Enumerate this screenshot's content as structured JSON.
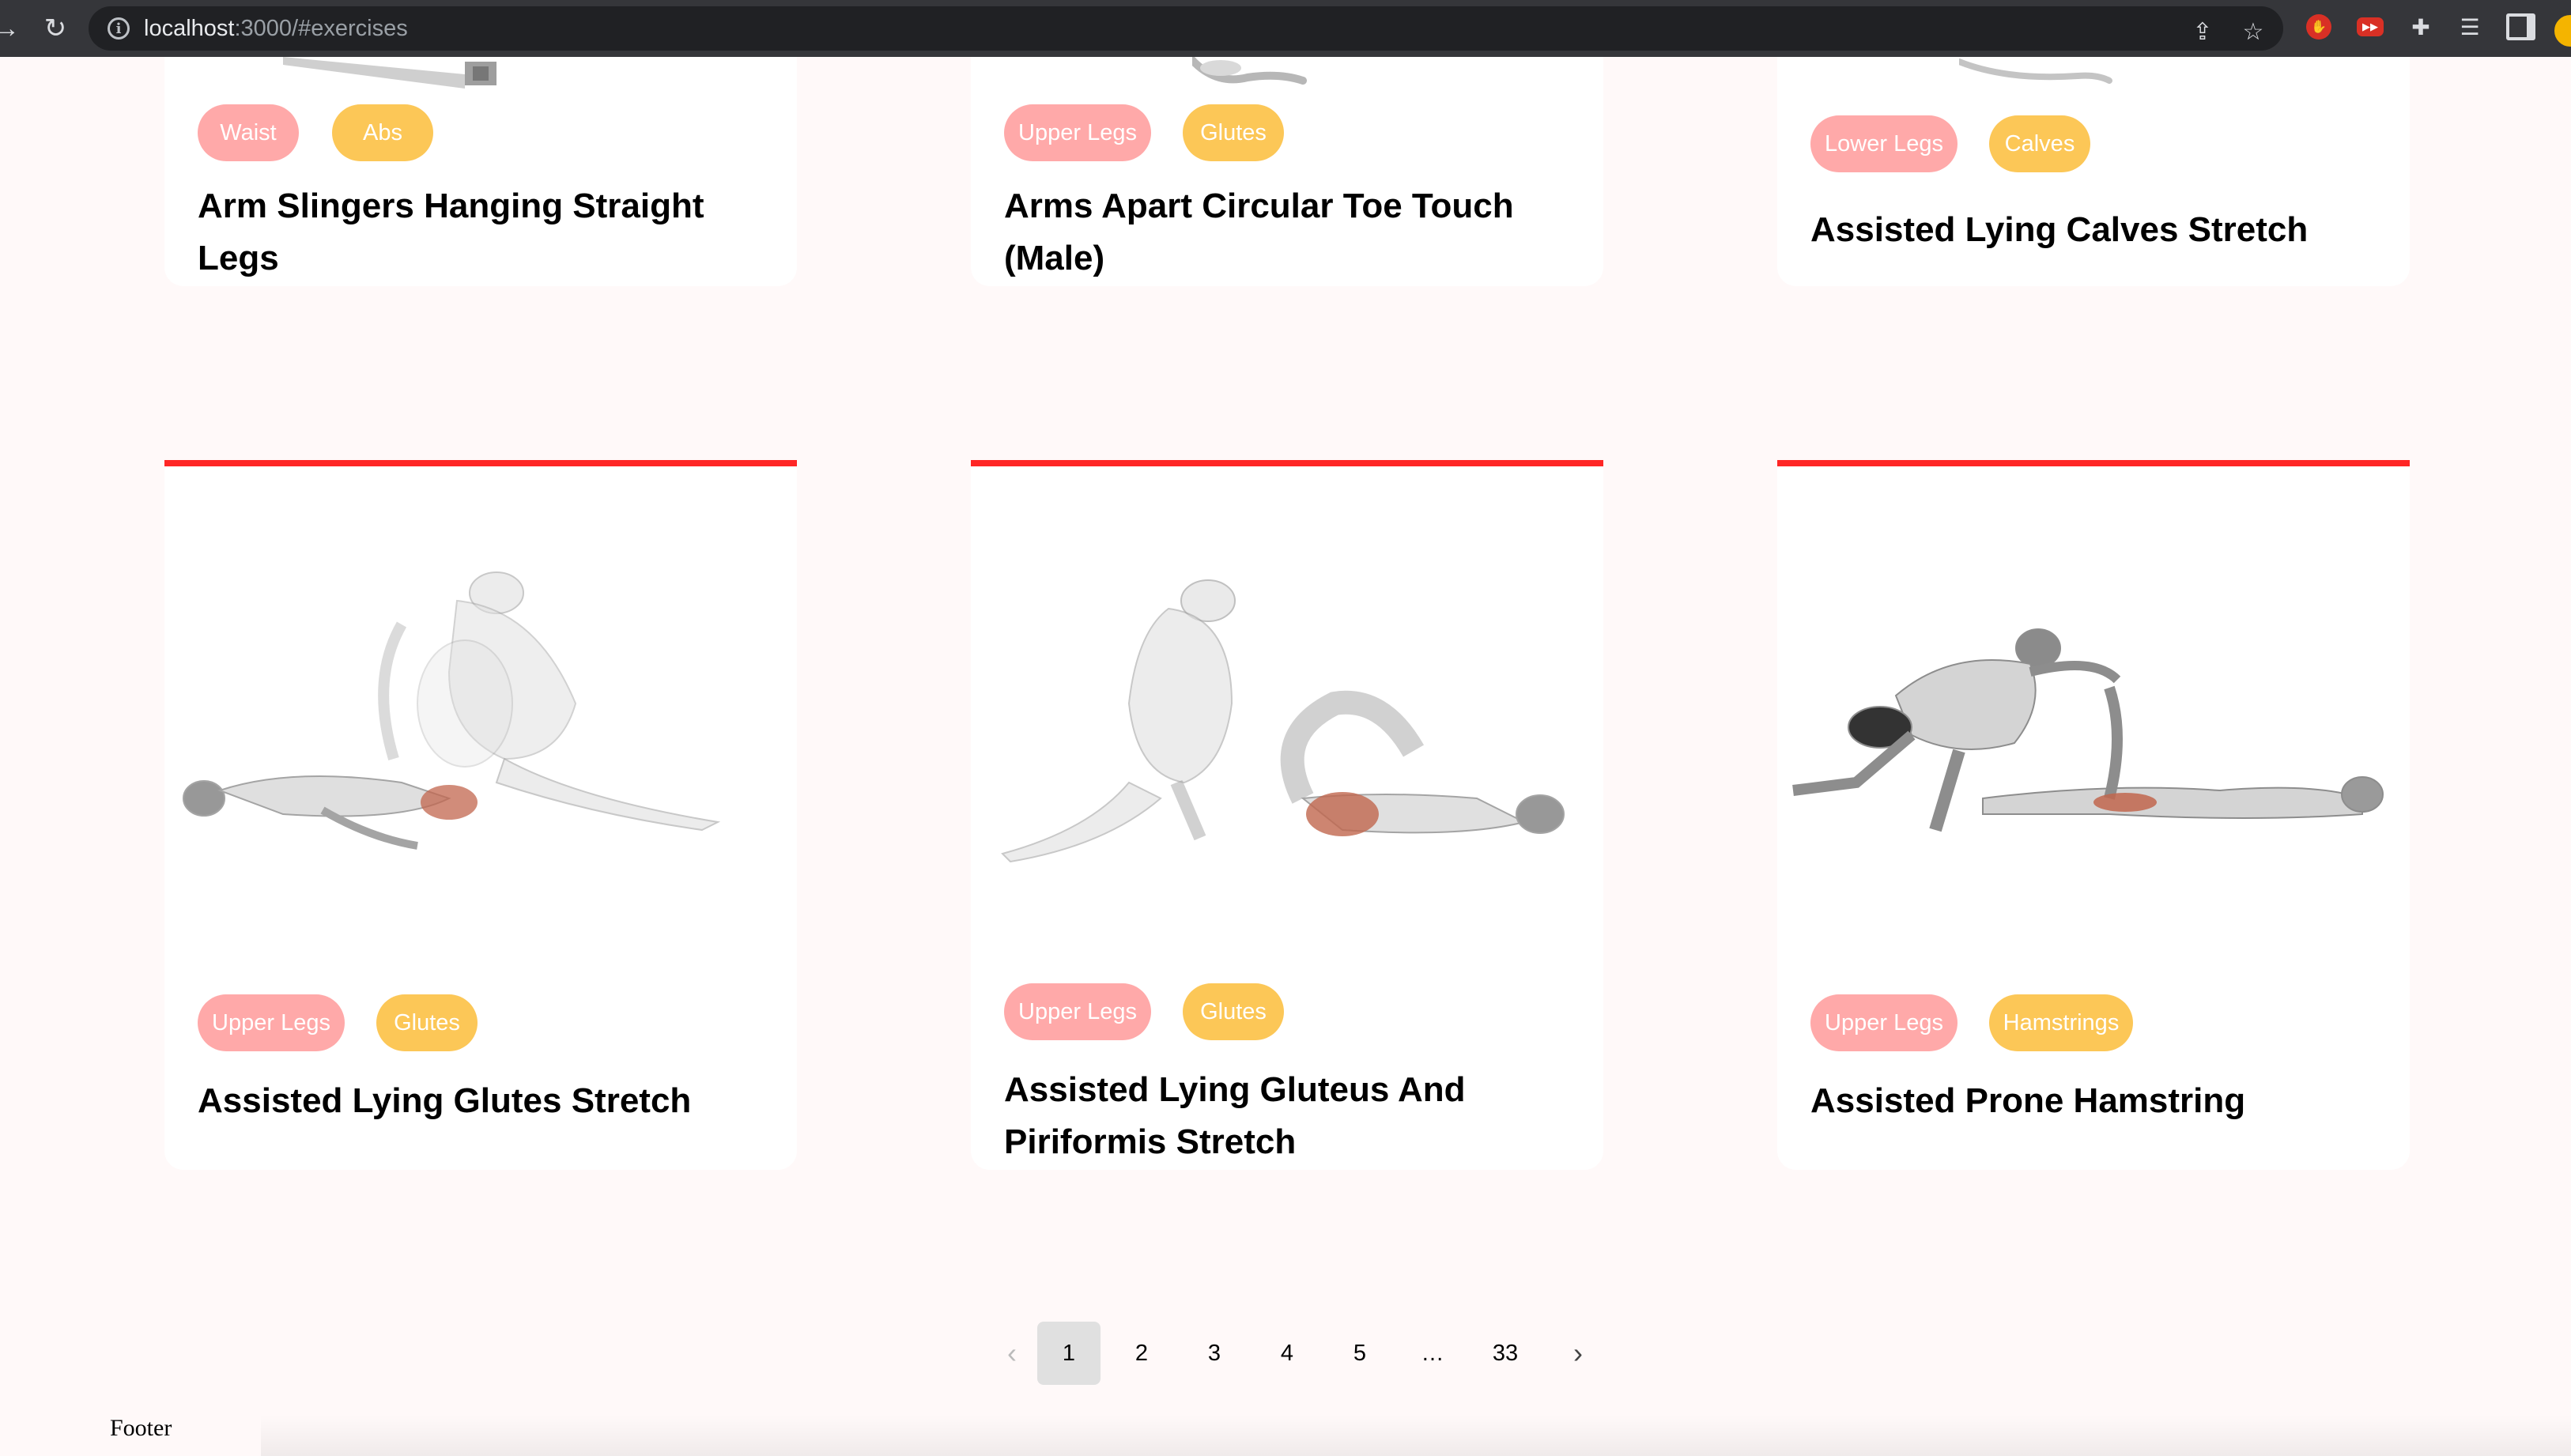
{
  "browser": {
    "url_host": "localhost",
    "url_rest": ":3000/#exercises"
  },
  "partial_cards": [
    {
      "body_part": "Waist",
      "target": "Abs",
      "name": "Arm Slingers Hanging Straight Legs"
    },
    {
      "body_part": "Upper Legs",
      "target": "Glutes",
      "name": "Arms Apart Circular Toe Touch (Male)"
    },
    {
      "body_part": "Lower Legs",
      "target": "Calves",
      "name": "Assisted Lying Calves Stretch"
    }
  ],
  "cards": [
    {
      "body_part": "Upper Legs",
      "target": "Glutes",
      "name": "Assisted Lying Glutes Stretch"
    },
    {
      "body_part": "Upper Legs",
      "target": "Glutes",
      "name": "Assisted Lying Gluteus And Piriformis Stretch"
    },
    {
      "body_part": "Upper Legs",
      "target": "Hamstrings",
      "name": "Assisted Prone Hamstring"
    }
  ],
  "pagination": {
    "prev_icon": "chevron-left",
    "next_icon": "chevron-right",
    "pages": [
      "1",
      "2",
      "3",
      "4",
      "5",
      "…",
      "33"
    ],
    "current": "1"
  },
  "footer": {
    "text": "Footer"
  },
  "colors": {
    "accent": "#ff2625",
    "body_part_pill": "#ffa9a9",
    "target_pill": "#fcc757",
    "page_bg": "#fff9f9"
  }
}
